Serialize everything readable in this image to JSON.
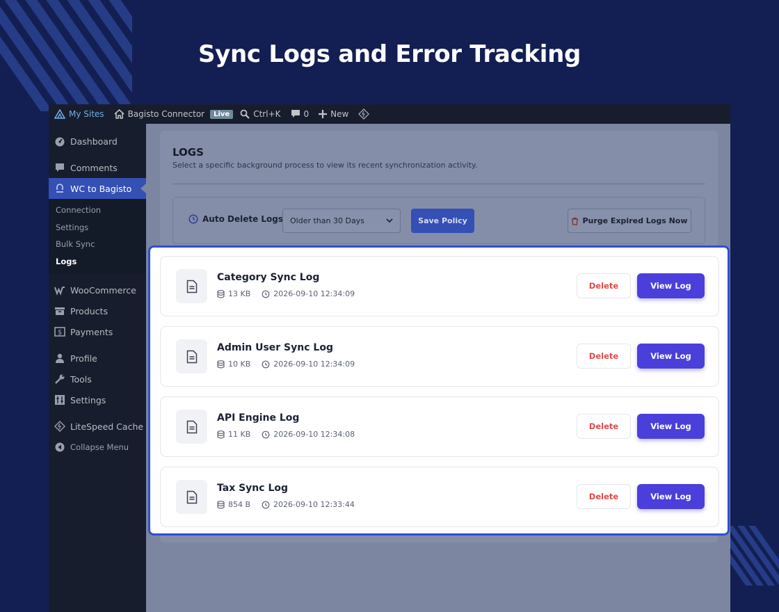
{
  "hero": {
    "title": "Sync Logs and Error Tracking"
  },
  "adminbar": {
    "my_sites": "My Sites",
    "site_name": "Bagisto Connector",
    "live_badge": "Live",
    "search_shortcut": "Ctrl+K",
    "comments_count": "0",
    "new_label": "New"
  },
  "sidebar": {
    "items_top": [
      {
        "label": "Dashboard",
        "icon": "dashboard-icon"
      },
      {
        "label": "Comments",
        "icon": "comment-icon"
      },
      {
        "label": "WC to Bagisto",
        "icon": "plugin-icon"
      }
    ],
    "submenu": [
      "Connection",
      "Settings",
      "Bulk Sync",
      "Logs"
    ],
    "items_mid": [
      {
        "label": "WooCommerce",
        "icon": "woocommerce-icon"
      },
      {
        "label": "Products",
        "icon": "products-icon"
      },
      {
        "label": "Payments",
        "icon": "payments-icon"
      }
    ],
    "items_bottom": [
      {
        "label": "Profile",
        "icon": "user-icon"
      },
      {
        "label": "Tools",
        "icon": "wrench-icon"
      },
      {
        "label": "Settings",
        "icon": "settings-icon"
      }
    ],
    "litespeed": "LiteSpeed Cache",
    "collapse": "Collapse Menu"
  },
  "logs_page": {
    "title": "LOGS",
    "subtitle": "Select a specific background process to view its recent synchronization activity.",
    "auto_delete_label": "Auto Delete Logs:",
    "auto_delete_value": "Older than 30 Days",
    "save_policy": "Save Policy",
    "purge": "Purge Expired Logs Now"
  },
  "log_actions": {
    "delete": "Delete",
    "view": "View Log"
  },
  "logs": [
    {
      "name": "Category Sync Log",
      "size": "13 KB",
      "time": "2026-09-10 12:34:09"
    },
    {
      "name": "Admin User Sync Log",
      "size": "10 KB",
      "time": "2026-09-10 12:34:09"
    },
    {
      "name": "API Engine Log",
      "size": "11 KB",
      "time": "2026-09-10 12:34:08"
    },
    {
      "name": "Tax Sync Log",
      "size": "854 B",
      "time": "2026-09-10 12:33:44"
    }
  ],
  "colors": {
    "accent": "#4b3fdb",
    "wp_active": "#3450b5",
    "danger": "#e04b4b",
    "background": "#131f52"
  }
}
